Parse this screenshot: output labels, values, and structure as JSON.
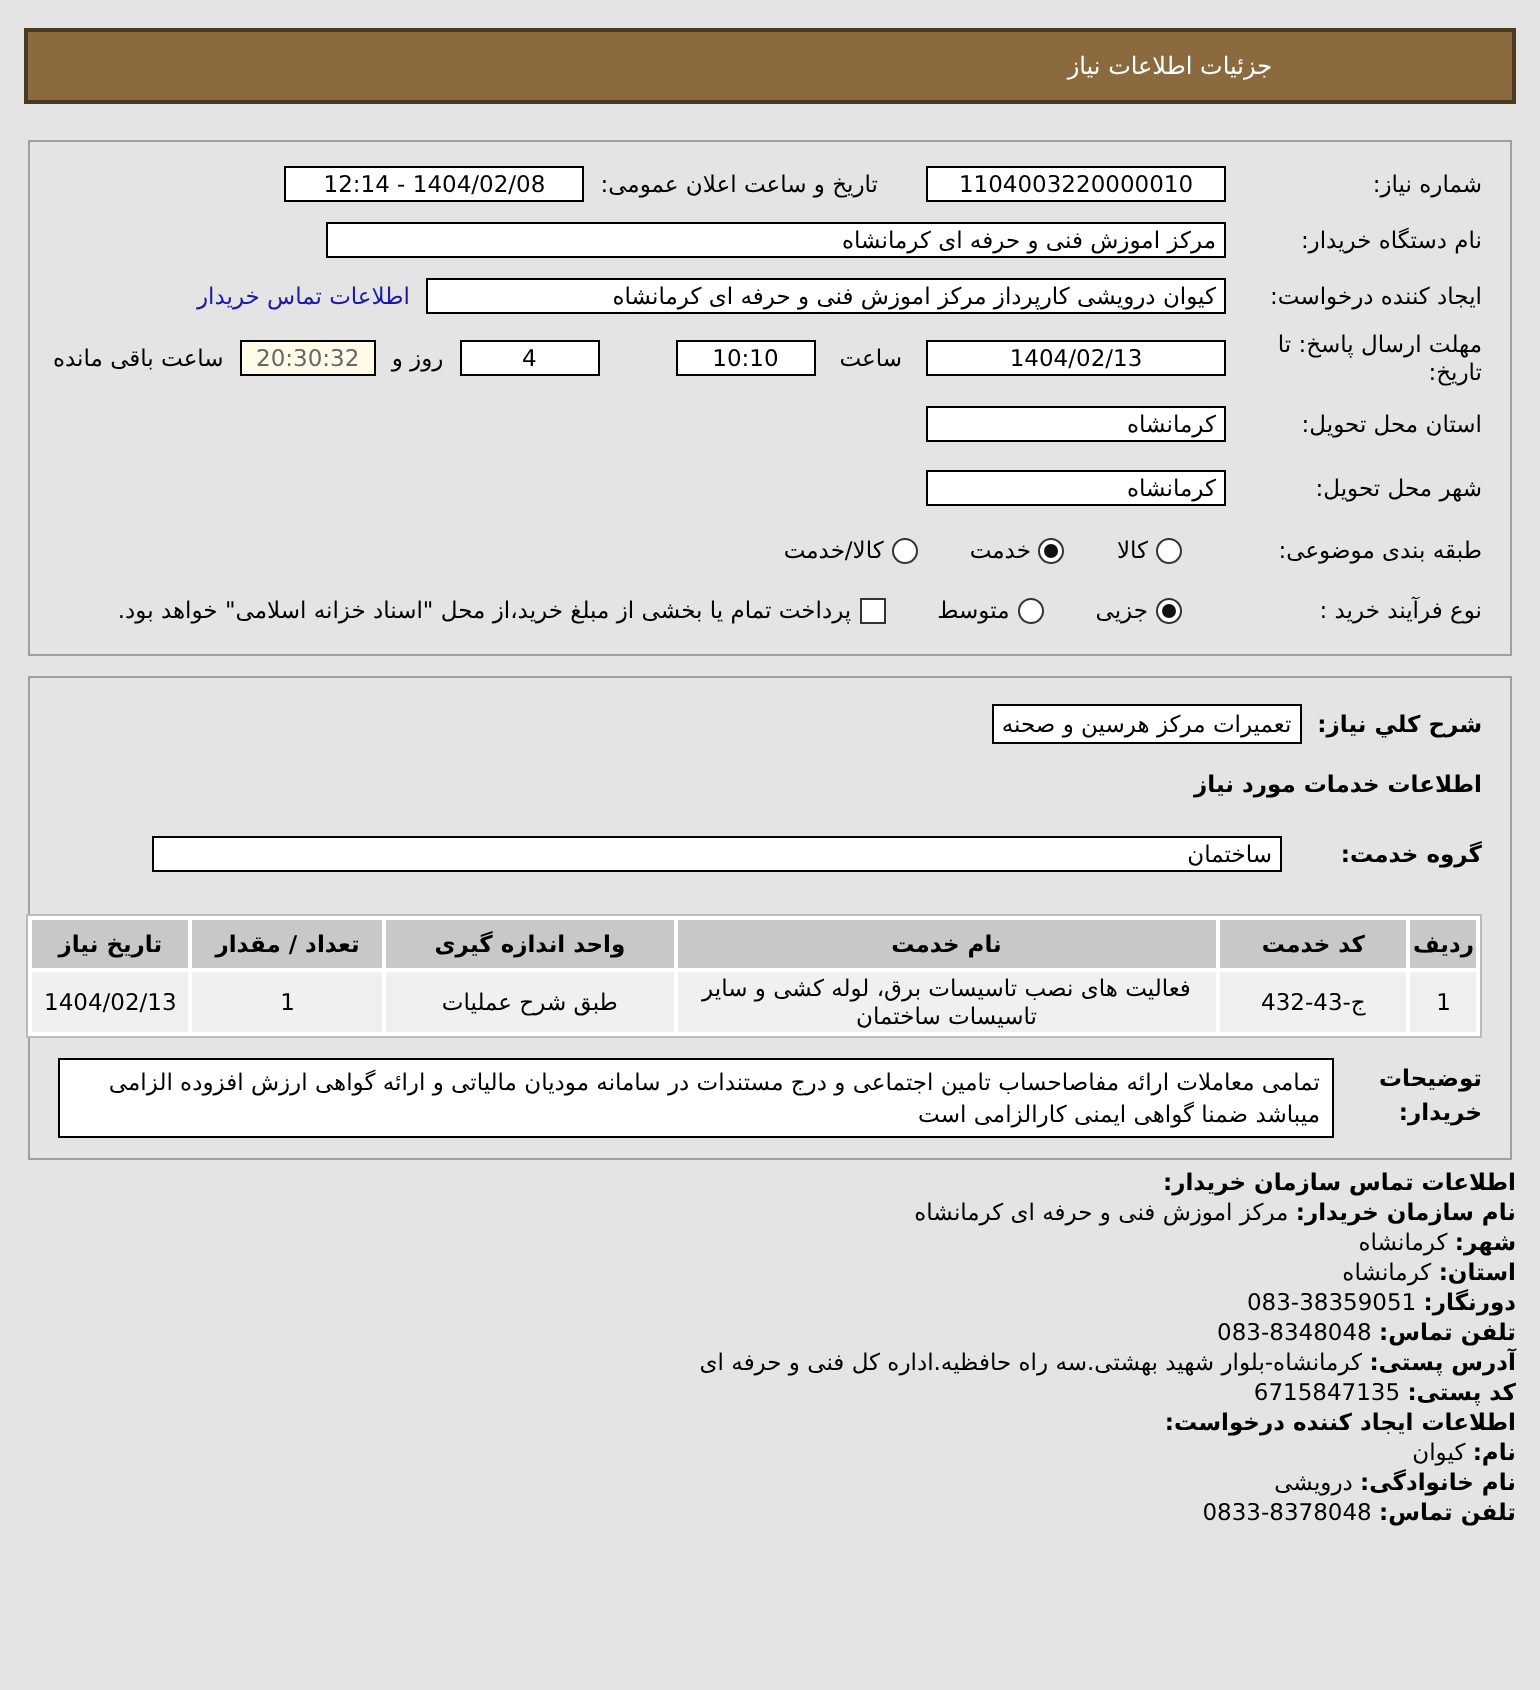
{
  "header": {
    "title": "جزئیات اطلاعات نیاز"
  },
  "need": {
    "need_number": {
      "label": "شماره نیاز:",
      "value": "1104003220000010"
    },
    "announce": {
      "label": "تاریخ و ساعت اعلان عمومی:",
      "value": "1404/02/08 - 12:14"
    },
    "buyer_org": {
      "label": "نام دستگاه خریدار:",
      "value": "مرکز اموزش فنی و حرفه ای کرمانشاه"
    },
    "requester": {
      "label": "ایجاد کننده درخواست:",
      "value": "کیوان درویشی کارپرداز مرکز اموزش فنی و حرفه ای کرمانشاه",
      "link": "اطلاعات تماس خریدار"
    },
    "deadline": {
      "label": "مهلت ارسال پاسخ: تا تاریخ:",
      "date": "1404/02/13",
      "time_label": "ساعت",
      "time": "10:10",
      "days": "4",
      "days_label": "روز و",
      "countdown": "20:30:32",
      "countdown_label": "ساعت باقی مانده"
    },
    "province": {
      "label": "استان محل تحویل:",
      "value": "کرمانشاه"
    },
    "city": {
      "label": "شهر محل تحویل:",
      "value": "کرمانشاه"
    },
    "category": {
      "label": "طبقه بندی موضوعی:",
      "options": [
        {
          "label": "کالا",
          "selected": false
        },
        {
          "label": "خدمت",
          "selected": true
        },
        {
          "label": "کالا/خدمت",
          "selected": false
        }
      ]
    },
    "process": {
      "label": "نوع فرآیند خرید :",
      "options": [
        {
          "label": "جزیی",
          "selected": true
        },
        {
          "label": "متوسط",
          "selected": false
        }
      ],
      "checkbox": {
        "label": "پرداخت تمام یا بخشی از مبلغ خرید،از محل \"اسناد خزانه اسلامی\" خواهد بود.",
        "checked": false
      }
    }
  },
  "services": {
    "description": {
      "label": "شرح کلي نياز:",
      "value": "تعمیرات مرکز هرسین و صحنه"
    },
    "title": "اطلاعات خدمات مورد نیاز",
    "group": {
      "label": "گروه خدمت:",
      "value": "ساختمان"
    },
    "table": {
      "columns": [
        "ردیف",
        "کد خدمت",
        "نام خدمت",
        "واحد اندازه گیری",
        "تعداد / مقدار",
        "تاریخ نیاز"
      ],
      "rows": [
        [
          "1",
          "ج-43-432",
          "فعالیت های نصب تاسیسات برق، لوله کشی و سایر تاسیسات ساختمان",
          "طبق شرح عملیات",
          "1",
          "1404/02/13"
        ]
      ]
    },
    "notes": {
      "label": "توضیحات خریدار:",
      "text": "تمامی معاملات ارائه مفاصاحساب تامین اجتماعی و درج مستندات در سامانه مودیان مالیاتی و ارائه گواهی ارزش افزوده الزامی میباشد ضمنا گواهی ایمنی کارالزامی است"
    }
  },
  "contact": [
    {
      "kind": "heading",
      "text": "اطلاعات تماس سازمان خریدار:"
    },
    {
      "kind": "field",
      "label": "نام سازمان خریدار:",
      "value": "مرکز اموزش فنی و حرفه ای کرمانشاه"
    },
    {
      "kind": "field",
      "label": "شهر:",
      "value": "کرمانشاه"
    },
    {
      "kind": "field",
      "label": "استان:",
      "value": "کرمانشاه"
    },
    {
      "kind": "field",
      "label": "دورنگار:",
      "value": "38359051-083"
    },
    {
      "kind": "field",
      "label": "تلفن تماس:",
      "value": "8348048-083"
    },
    {
      "kind": "field",
      "label": "آدرس پستی:",
      "value": "کرمانشاه-بلوار شهید بهشتی.سه راه حافظیه.اداره کل فنی و حرفه ای"
    },
    {
      "kind": "field",
      "label": "کد پستی:",
      "value": "6715847135"
    },
    {
      "kind": "heading",
      "text": "اطلاعات ایجاد کننده درخواست:"
    },
    {
      "kind": "field",
      "label": "نام:",
      "value": "کیوان"
    },
    {
      "kind": "field",
      "label": "نام خانوادگی:",
      "value": "درویشی"
    },
    {
      "kind": "field",
      "label": "تلفن تماس:",
      "value": "8378048-0833"
    }
  ]
}
